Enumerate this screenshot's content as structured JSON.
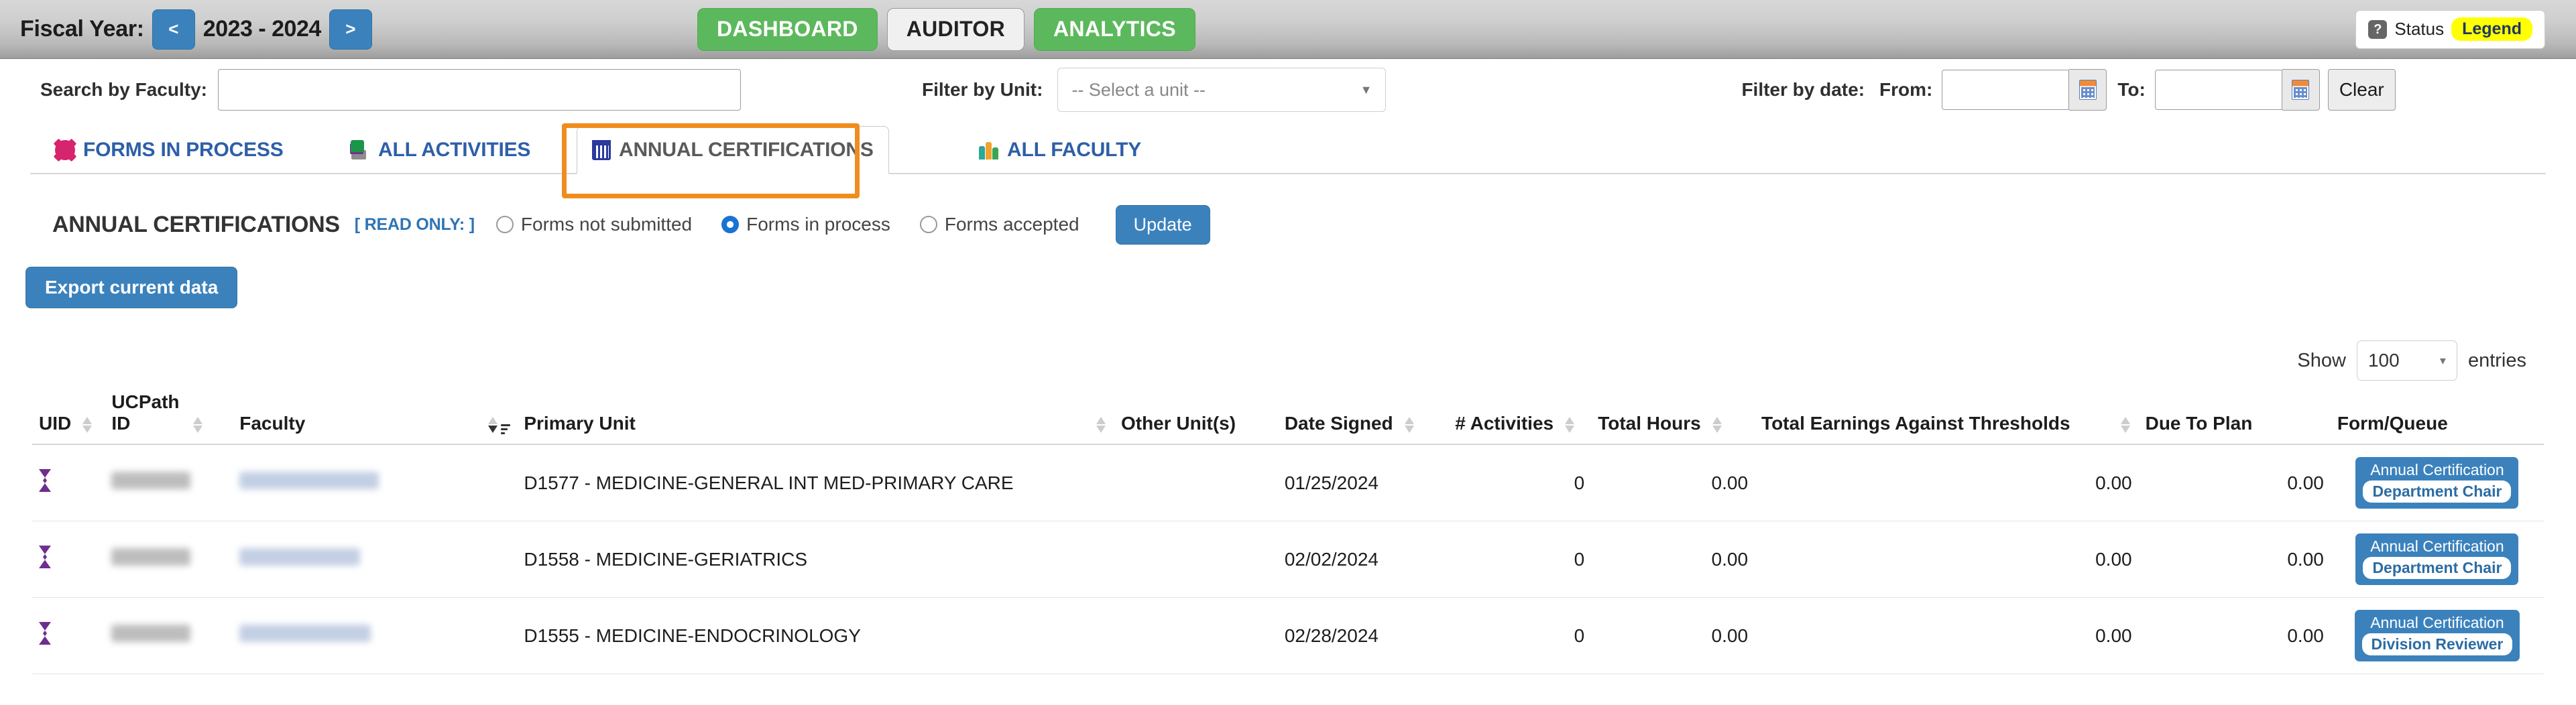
{
  "topbar": {
    "fiscal_year_label": "Fiscal Year:",
    "prev_label": "<",
    "next_label": ">",
    "fiscal_year_value": "2023 - 2024",
    "nav": [
      {
        "label": "DASHBOARD",
        "style": "green"
      },
      {
        "label": "AUDITOR",
        "style": "white"
      },
      {
        "label": "ANALYTICS",
        "style": "green"
      }
    ],
    "status": {
      "help_glyph": "?",
      "label": "Status",
      "legend_label": "Legend"
    }
  },
  "filters": {
    "search_label": "Search by Faculty:",
    "search_value": "",
    "search_placeholder": "",
    "unit_label": "Filter by Unit:",
    "unit_selected": "-- Select a unit --",
    "date_label": "Filter by date:",
    "from_label": "From:",
    "from_value": "",
    "to_label": "To:",
    "to_value": "",
    "clear_label": "Clear"
  },
  "tabs": [
    {
      "label": "FORMS IN PROCESS",
      "icon": "gear-icon",
      "active": false
    },
    {
      "label": "ALL ACTIVITIES",
      "icon": "books-icon",
      "active": false
    },
    {
      "label": "ANNUAL CERTIFICATIONS",
      "icon": "calendar-icon",
      "active": true
    },
    {
      "label": "ALL FACULTY",
      "icon": "people-icon",
      "active": false
    }
  ],
  "section": {
    "title": "ANNUAL CERTIFICATIONS",
    "readonly_badge": "[ READ ONLY: ]",
    "radios": [
      {
        "label": "Forms not submitted",
        "selected": false
      },
      {
        "label": "Forms in process",
        "selected": true
      },
      {
        "label": "Forms accepted",
        "selected": false
      }
    ],
    "update_label": "Update",
    "export_label": "Export current data"
  },
  "table_controls": {
    "show_label": "Show",
    "entries_value": "100",
    "entries_label": "entries"
  },
  "table": {
    "columns": [
      {
        "key": "uid",
        "label": "UID",
        "sort": "both",
        "align": "left"
      },
      {
        "key": "ucp",
        "label": "UCPath ID",
        "sort": "both",
        "align": "left"
      },
      {
        "key": "fac",
        "label": "Faculty",
        "sort": "active",
        "align": "left"
      },
      {
        "key": "unit",
        "label": "Primary Unit",
        "sort": "both",
        "align": "left"
      },
      {
        "key": "other",
        "label": "Other Unit(s)",
        "sort": "none",
        "align": "left"
      },
      {
        "key": "date",
        "label": "Date Signed",
        "sort": "both",
        "align": "left"
      },
      {
        "key": "act",
        "label": "# Activities",
        "sort": "both",
        "align": "right"
      },
      {
        "key": "hours",
        "label": "Total Hours",
        "sort": "both",
        "align": "right"
      },
      {
        "key": "earn",
        "label": "Total Earnings Against Thresholds",
        "sort": "both",
        "align": "right"
      },
      {
        "key": "due",
        "label": "Due To Plan",
        "sort": "none",
        "align": "right"
      },
      {
        "key": "form",
        "label": "Form/Queue",
        "sort": "none",
        "align": "center"
      }
    ],
    "rows": [
      {
        "uid_icon": "record-icon",
        "ucp": "",
        "faculty": "",
        "unit": "D1577 - MEDICINE-GENERAL INT MED-PRIMARY CARE",
        "other": "",
        "date": "01/25/2024",
        "activities": "0",
        "hours": "0.00",
        "earnings": "0.00",
        "due": "0.00",
        "form_title": "Annual Certification",
        "form_queue": "Department Chair"
      },
      {
        "uid_icon": "record-icon",
        "ucp": "",
        "faculty": "",
        "unit": "D1558 - MEDICINE-GERIATRICS",
        "other": "",
        "date": "02/02/2024",
        "activities": "0",
        "hours": "0.00",
        "earnings": "0.00",
        "due": "0.00",
        "form_title": "Annual Certification",
        "form_queue": "Department Chair"
      },
      {
        "uid_icon": "record-icon",
        "ucp": "",
        "faculty": "",
        "unit": "D1555 - MEDICINE-ENDOCRINOLOGY",
        "other": "",
        "date": "02/28/2024",
        "activities": "0",
        "hours": "0.00",
        "earnings": "0.00",
        "due": "0.00",
        "form_title": "Annual Certification",
        "form_queue": "Division Reviewer"
      }
    ]
  },
  "colors": {
    "primary_blue": "#3b82bd",
    "green": "#5cb85c",
    "highlight_orange": "#f08c1e",
    "legend_yellow": "#ffff00",
    "link_blue": "#2d5fa8",
    "purple_icon": "#6d2e8f"
  }
}
